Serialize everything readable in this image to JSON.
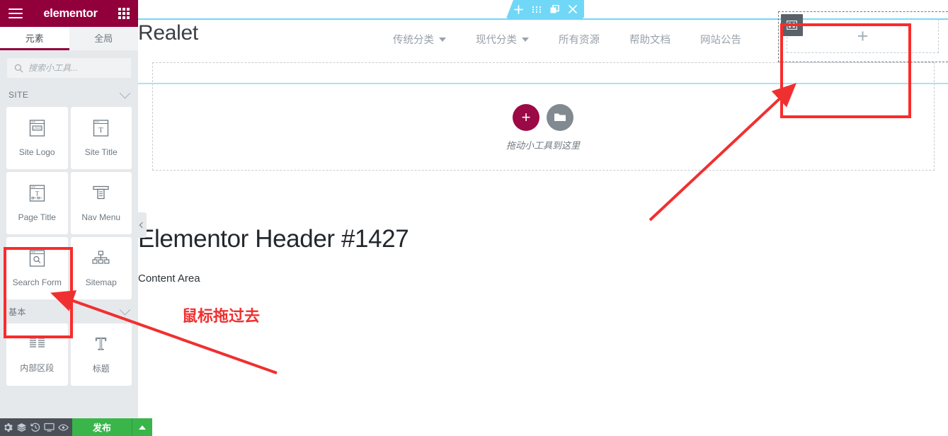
{
  "panel": {
    "brand": "elementor",
    "menu_icon": "hamburger-icon",
    "apps_icon": "grid-apps-icon",
    "tabs": [
      {
        "label": "元素",
        "active": true
      },
      {
        "label": "全局",
        "active": false
      }
    ],
    "search": {
      "placeholder": "搜索小工具...",
      "value": "",
      "icon": "search-icon"
    },
    "categories": [
      {
        "label": "SITE",
        "collapse_icon": "chevron-down-icon",
        "widgets": [
          {
            "label": "Site Logo",
            "icon": "site-logo-icon"
          },
          {
            "label": "Site Title",
            "icon": "site-title-icon"
          },
          {
            "label": "Page Title",
            "icon": "page-title-icon"
          },
          {
            "label": "Nav Menu",
            "icon": "nav-menu-icon"
          },
          {
            "label": "Search Form",
            "icon": "search-form-icon"
          },
          {
            "label": "Sitemap",
            "icon": "sitemap-icon"
          }
        ]
      },
      {
        "label": "基本",
        "collapse_icon": "chevron-down-icon",
        "widgets": [
          {
            "label": "内部区段",
            "icon": "inner-section-icon"
          },
          {
            "label": "标题",
            "icon": "heading-icon"
          }
        ]
      }
    ],
    "footer": {
      "icons": [
        "settings-gear-icon",
        "navigator-layers-icon",
        "history-clock-icon",
        "responsive-monitor-icon",
        "preview-eye-icon"
      ],
      "publish_label": "发布",
      "publish_caret_icon": "caret-up-icon"
    },
    "collapse_handle_icon": "chevron-left-icon"
  },
  "canvas": {
    "section_toolbar": {
      "icons": [
        "add-section-icon",
        "drag-handle-icon",
        "duplicate-icon",
        "close-icon"
      ]
    },
    "site": {
      "logo_text": "Realet",
      "nav": [
        {
          "label": "传统分类",
          "has_dropdown": true
        },
        {
          "label": "现代分类",
          "has_dropdown": true
        },
        {
          "label": "所有资源",
          "has_dropdown": false
        },
        {
          "label": "帮助文档",
          "has_dropdown": false
        },
        {
          "label": "网站公告",
          "has_dropdown": false
        }
      ]
    },
    "column_handle_icon": "column-layout-icon",
    "empty_drop_plus": "+",
    "widget_drop": {
      "add_icon": "plus-circle-icon",
      "folder_icon": "template-folder-icon",
      "hint": "拖动小工具到这里"
    },
    "page_title": "Elementor Header #1427",
    "content_area_label": "Content Area"
  },
  "annotations": {
    "note": "鼠标拖过去",
    "rect_color": "#fa2b2b",
    "arrow_color": "#f03030",
    "rect_search_form": "highlight around Search Form widget",
    "rect_drop_target": "highlight around header right column drop area"
  }
}
